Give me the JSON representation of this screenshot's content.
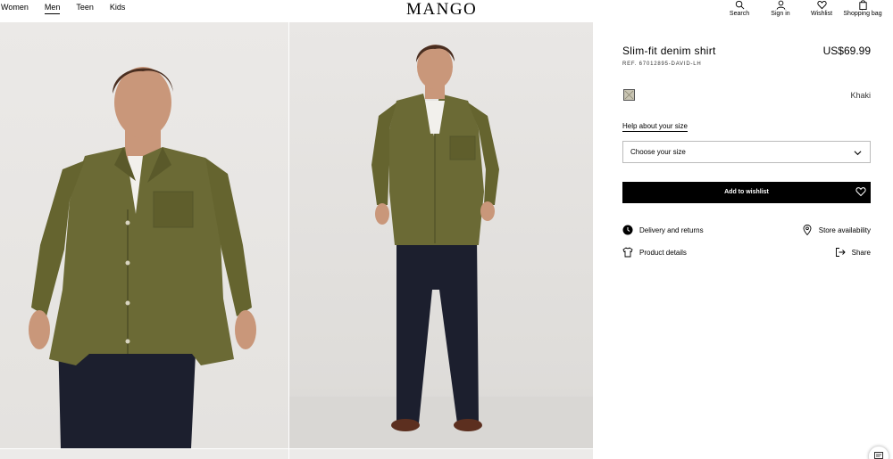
{
  "nav": {
    "items": [
      {
        "label": "Women"
      },
      {
        "label": "Men"
      },
      {
        "label": "Teen"
      },
      {
        "label": "Kids"
      }
    ],
    "active": "Men"
  },
  "logo": "MANGO",
  "header_actions": {
    "search": {
      "label": "Search",
      "icon": "search-icon"
    },
    "sign_in": {
      "label": "Sign in",
      "icon": "user-icon"
    },
    "wishlist": {
      "label": "Wishlist",
      "icon": "heart-icon"
    },
    "bag": {
      "label": "Shopping bag",
      "icon": "bag-icon"
    }
  },
  "product": {
    "title": "Slim-fit denim shirt",
    "price": "US$69.99",
    "ref": "REF. 67012895-DAVID-LH",
    "color_name": "Khaki",
    "help_size": "Help about your size",
    "size_placeholder": "Choose your size",
    "wishlist_button": "Add to wishlist",
    "links": {
      "delivery": "Delivery and returns",
      "details": "Product details",
      "store": "Store availability",
      "share": "Share"
    }
  },
  "colors": {
    "shirt": "#6b6a35",
    "shirt_dark": "#55552a",
    "jeans": "#1c1f2e",
    "skin": "#c9977a",
    "hair": "#4a2e20",
    "shoes": "#5c2f1f",
    "swatch": "#c9c5b4"
  }
}
